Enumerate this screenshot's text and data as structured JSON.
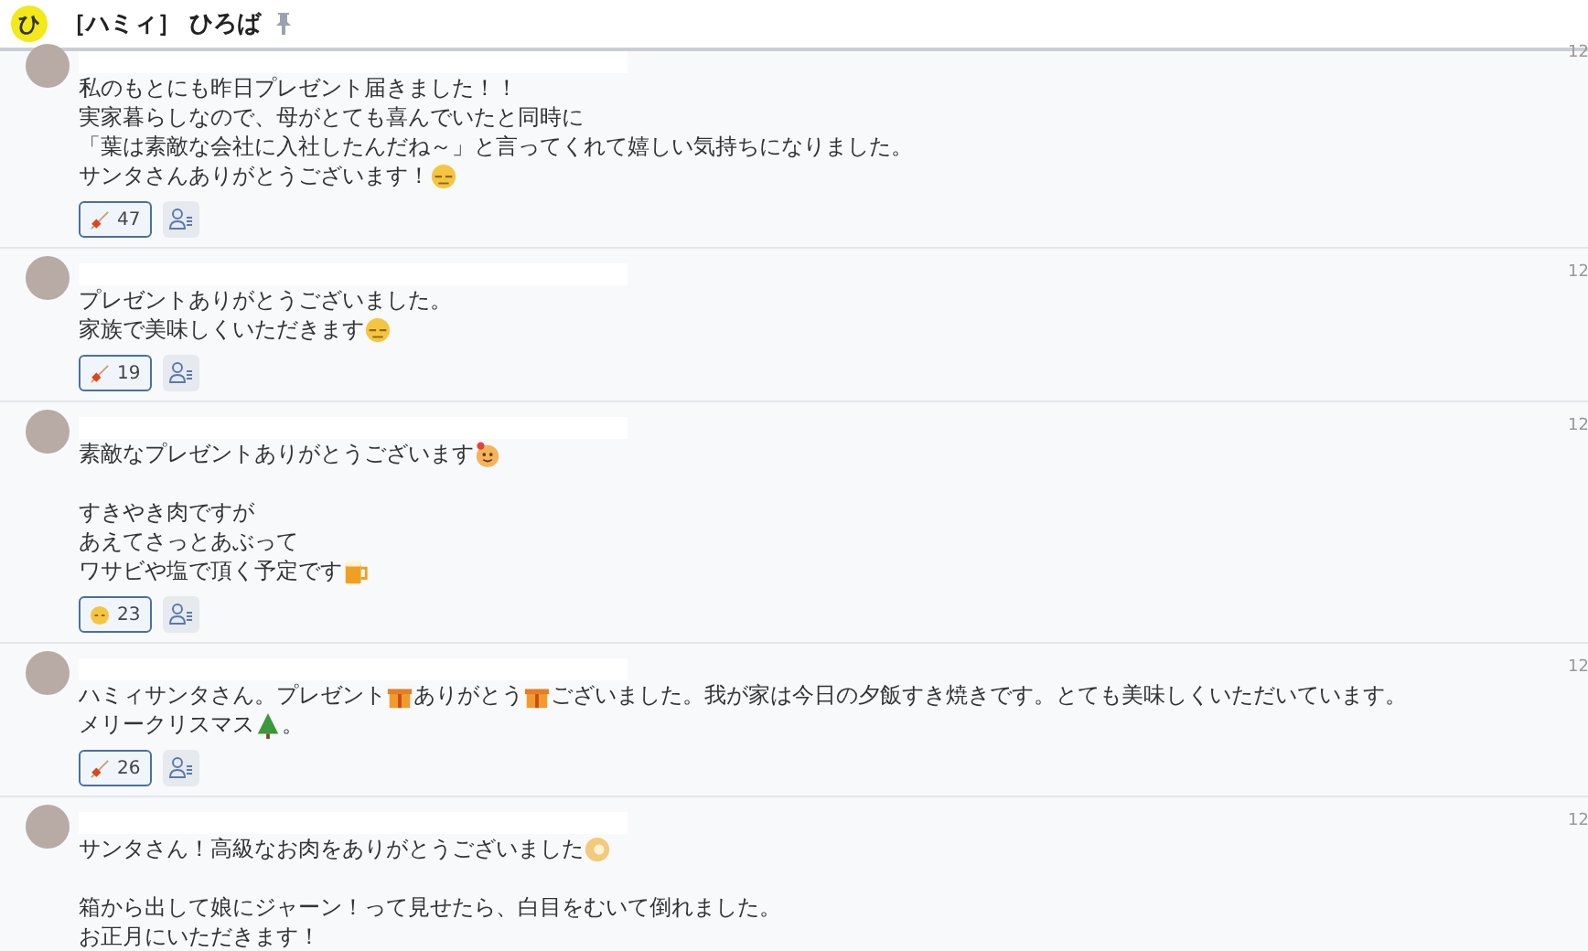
{
  "header": {
    "badge": "ひ",
    "title": "［ハミィ］ ひろば"
  },
  "messages": [
    {
      "time": "12",
      "paragraphs": [
        [
          [
            {
              "kind": "text",
              "text": "私のもとにも昨日プレゼント届きました！！"
            }
          ],
          [
            {
              "kind": "text",
              "text": "実家暮らしなので、母がとても喜んでいたと同時に"
            }
          ],
          [
            {
              "kind": "text",
              "text": "「葉は素敵な会社に入社したんだね～」と言ってくれて嬉しい気持ちになりました。"
            }
          ],
          [
            {
              "kind": "text",
              "text": "サンタさんありがとうございます！"
            },
            {
              "kind": "face"
            }
          ]
        ]
      ],
      "reactions": [
        {
          "kind": "skewer",
          "count": "47",
          "selected": true
        }
      ]
    },
    {
      "time": "12",
      "paragraphs": [
        [
          [
            {
              "kind": "text",
              "text": "プレゼントありがとうございました。"
            }
          ],
          [
            {
              "kind": "text",
              "text": "家族で美味しくいただきます"
            },
            {
              "kind": "face"
            }
          ]
        ]
      ],
      "reactions": [
        {
          "kind": "skewer",
          "count": "19",
          "selected": true
        }
      ]
    },
    {
      "time": "12",
      "paragraphs": [
        [
          [
            {
              "kind": "text",
              "text": "素敵なプレゼントありがとうございます"
            },
            {
              "kind": "smile"
            }
          ]
        ],
        [
          [
            {
              "kind": "text",
              "text": "すきやき肉ですが"
            }
          ],
          [
            {
              "kind": "text",
              "text": "あえてさっとあぶって"
            }
          ],
          [
            {
              "kind": "text",
              "text": "ワサビや塩で頂く予定です"
            },
            {
              "kind": "mug"
            }
          ]
        ]
      ],
      "reactions": [
        {
          "kind": "face",
          "count": "23",
          "selected": true
        }
      ]
    },
    {
      "time": "12",
      "paragraphs": [
        [
          [
            {
              "kind": "text",
              "text": "ハミィサンタさん。プレゼント"
            },
            {
              "kind": "gift"
            },
            {
              "kind": "text",
              "text": "ありがとう"
            },
            {
              "kind": "gift"
            },
            {
              "kind": "text",
              "text": "ございました。我が家は今日の夕飯すき焼きです。とても美味しくいただいています。"
            }
          ],
          [
            {
              "kind": "text",
              "text": "メリークリスマス"
            },
            {
              "kind": "tree"
            },
            {
              "kind": "text",
              "text": "。"
            }
          ]
        ]
      ],
      "reactions": [
        {
          "kind": "skewer",
          "count": "26",
          "selected": true
        }
      ]
    },
    {
      "time": "12",
      "paragraphs": [
        [
          [
            {
              "kind": "text",
              "text": "サンタさん！高級なお肉をありがとうございました"
            },
            {
              "kind": "round"
            }
          ]
        ],
        [
          [
            {
              "kind": "text",
              "text": "箱から出して娘にジャーン！って見せたら、白目をむいて倒れました。"
            }
          ],
          [
            {
              "kind": "text",
              "text": "お正月にいただきます！"
            }
          ]
        ]
      ]
    }
  ]
}
